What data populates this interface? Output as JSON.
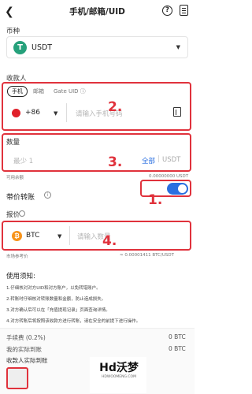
{
  "header": {
    "back_icon": "chevron-left-icon",
    "title": "手机/邮箱/UID",
    "help_icon": "help-circle-icon",
    "doc_icon": "document-icon",
    "help_glyph": "?"
  },
  "coin": {
    "label": "币种",
    "symbol_glyph": "T",
    "name": "USDT"
  },
  "recipient": {
    "label": "收款人",
    "tabs": [
      "手机",
      "邮箱",
      "Gate UID ⓘ"
    ],
    "active_tab": "手机",
    "country_code": "+86",
    "phone_placeholder": "请输入手机号码",
    "contacts_icon": "contacts-book-icon"
  },
  "amount": {
    "label": "数量",
    "placeholder": "最少 1",
    "all_label": "全部",
    "unit": "USDT",
    "available_label": "可用余额",
    "available_value": "0.00000000 USDT"
  },
  "transfer_with_price": {
    "label": "带价转账",
    "info_icon": "info-circle-icon",
    "enabled": true
  },
  "quote": {
    "label": "报价",
    "info_icon": "info-circle-icon",
    "coin": "BTC",
    "coin_glyph": "₿",
    "amount_placeholder": "请输入数量",
    "rate_label": "市场参考价",
    "rate_value": "≈ 0.00001411 BTC/USDT"
  },
  "notice": {
    "title": "使用须知:",
    "items": [
      "1.仔细核对对方UID和对方账户，以免转错账户。",
      "2.转账时仔细核对转账数量和金额，防止造成损失。",
      "3.对方确认后可以在「充值提现记录」页面查询详情。",
      "4.对方转账后将按照该收款方进行转账，请在安全的前提下进行操作。"
    ]
  },
  "summary": {
    "fee_label": "手续费 (0.2%)",
    "fee_value": "0 BTC",
    "received_label": "我的实际到账",
    "received_value": "0 BTC",
    "payee_label": "收款人实际到账"
  },
  "annotations": [
    "1.",
    "2.",
    "3.",
    "4."
  ],
  "watermark": {
    "logo_text": "Hd沃梦",
    "sub_text": "HDWOOMENG.COM"
  },
  "colors": {
    "annotation_red": "#e0323c",
    "toggle_blue": "#2a6fe0",
    "usdt_green": "#26a17b",
    "btc_orange": "#f7931a"
  }
}
